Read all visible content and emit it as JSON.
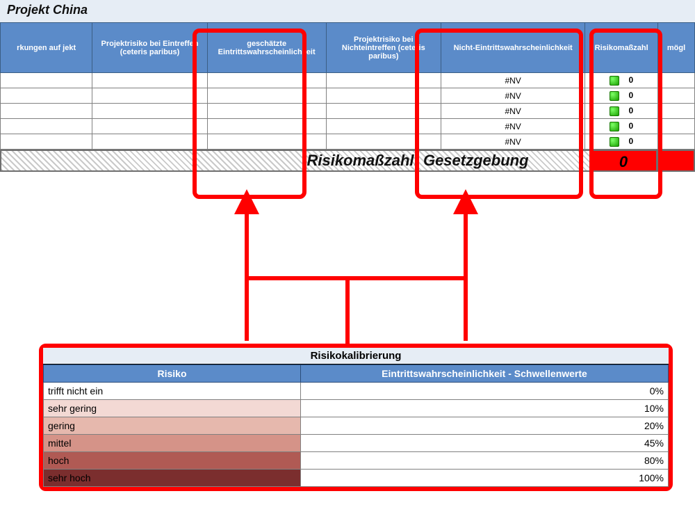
{
  "title": "Projekt China",
  "columns": {
    "c0": "rkungen auf\njekt",
    "c1": "Projektrisiko bei Eintreffen (ceteris paribus)",
    "c2": "geschätzte Eintrittswahrscheinlichkeit",
    "c3": "Projektrisiko bei Nichteintreffen (ceteris paribus)",
    "c4": "Nicht-Eintrittswahrscheinlichkeit",
    "c5": "Risikomaßzahl",
    "c6": "mögl"
  },
  "rows": [
    {
      "nv": "#NV",
      "risk": "0"
    },
    {
      "nv": "#NV",
      "risk": "0"
    },
    {
      "nv": "#NV",
      "risk": "0"
    },
    {
      "nv": "#NV",
      "risk": "0"
    },
    {
      "nv": "#NV",
      "risk": "0"
    }
  ],
  "summary": {
    "label": "Risikomaßzahl:   Gesetzgebung",
    "value": "0"
  },
  "calibration": {
    "title": "Risikokalibrierung",
    "col_left": "Risiko",
    "col_right": "Eintrittswahrscheinlichkeit - Schwellenwerte",
    "levels": [
      {
        "label": "trifft nicht ein",
        "pct": "0%"
      },
      {
        "label": "sehr gering",
        "pct": "10%"
      },
      {
        "label": "gering",
        "pct": "20%"
      },
      {
        "label": "mittel",
        "pct": "45%"
      },
      {
        "label": "hoch",
        "pct": "80%"
      },
      {
        "label": "sehr hoch",
        "pct": "100%"
      }
    ]
  }
}
